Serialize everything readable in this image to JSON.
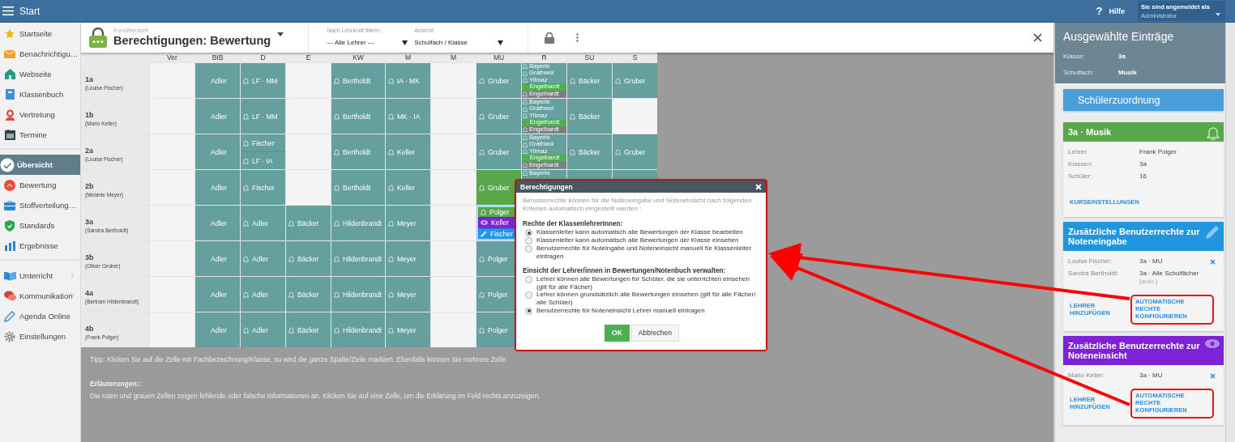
{
  "topbar": {
    "menu": "Start",
    "help_glyph": "?",
    "help": "Hilfe",
    "user_caption": "Sie sind angemeldet als",
    "user_name": "Administrator"
  },
  "sidebar": {
    "groups": [
      [
        {
          "label": "Startseite",
          "selected": false,
          "submenu": false
        },
        {
          "label": "Benachrichtigu…",
          "selected": false,
          "submenu": false
        },
        {
          "label": "Webseite",
          "selected": false,
          "submenu": false
        },
        {
          "label": "Klassenbuch",
          "selected": false,
          "submenu": false
        },
        {
          "label": "Vertretung",
          "selected": false,
          "submenu": false
        },
        {
          "label": "Termine",
          "selected": false,
          "submenu": false
        }
      ],
      [
        {
          "label": "Übersicht",
          "selected": true,
          "submenu": false
        },
        {
          "label": "Bewertung",
          "selected": false,
          "submenu": false
        },
        {
          "label": "Stoffverteilung…",
          "selected": false,
          "submenu": false
        },
        {
          "label": "Standards",
          "selected": false,
          "submenu": false
        },
        {
          "label": "Ergebnisse",
          "selected": false,
          "submenu": false
        }
      ],
      [
        {
          "label": "Unterricht",
          "selected": false,
          "submenu": true
        },
        {
          "label": "Kommunikation",
          "selected": false,
          "submenu": true
        },
        {
          "label": "Agenda Online",
          "selected": false,
          "submenu": false
        },
        {
          "label": "Einstellungen",
          "selected": false,
          "submenu": false
        }
      ]
    ]
  },
  "header": {
    "subtitle": "Kursübersicht",
    "title": "Berechtigungen: Bewertung",
    "filters": [
      {
        "label": "Nach Lehrkraft filtern:",
        "value": "--- Alle Lehrer ---"
      },
      {
        "label": "Ansicht:",
        "value": "Schulfach / Klasse"
      }
    ]
  },
  "grid": {
    "columns": [
      {
        "label": "Ver"
      },
      {
        "label": "BIB"
      },
      {
        "label": "D"
      },
      {
        "label": "E"
      },
      {
        "label": "KW"
      },
      {
        "label": "M"
      },
      {
        "label": "M"
      },
      {
        "label": "MU"
      },
      {
        "label": "R",
        "stacked": true
      },
      {
        "label": "SU"
      },
      {
        "label": "S"
      }
    ],
    "rows": [
      {
        "name": "1a",
        "teacher": "(Louise Fischer)",
        "cells": [
          {
            "filled": false,
            "selected": false
          },
          {
            "filled": true,
            "selected": false,
            "entries": [
              {
                "text": "Adler",
                "kind": "plain"
              }
            ]
          },
          {
            "filled": true,
            "selected": false,
            "entries": [
              {
                "text": "LF · MM",
                "kind": "notify"
              }
            ]
          },
          {
            "filled": false,
            "selected": false
          },
          {
            "filled": true,
            "selected": false,
            "entries": [
              {
                "text": "Bertholdt",
                "kind": "notify"
              }
            ]
          },
          {
            "filled": true,
            "selected": false,
            "entries": [
              {
                "text": "IA · MK",
                "kind": "notify"
              }
            ]
          },
          {
            "filled": false,
            "selected": false
          },
          {
            "filled": true,
            "selected": false,
            "entries": [
              {
                "text": "Gruber",
                "kind": "notify"
              }
            ]
          },
          {
            "filled": true,
            "selected": false,
            "entries": [
              {
                "text": "Bayerle",
                "kind": "notify"
              },
              {
                "text": "Grathwol",
                "kind": "notify"
              },
              {
                "text": "Yilmaz",
                "kind": "notify"
              },
              {
                "text": "Engelhardt",
                "kind": "plain",
                "color": "#4caf50"
              },
              {
                "text": "Engelhardt",
                "kind": "notify",
                "color": "#7d7d7d"
              }
            ]
          },
          {
            "filled": true,
            "selected": false,
            "entries": [
              {
                "text": "Bäcker",
                "kind": "notify"
              }
            ]
          },
          {
            "filled": true,
            "selected": false,
            "entries": [
              {
                "text": "Gruber",
                "kind": "notify"
              }
            ]
          }
        ]
      },
      {
        "name": "1b",
        "teacher": "(Mario Keller)",
        "cells": [
          {
            "filled": false,
            "selected": false
          },
          {
            "filled": true,
            "selected": false,
            "entries": [
              {
                "text": "Adler",
                "kind": "plain"
              }
            ]
          },
          {
            "filled": true,
            "selected": false,
            "entries": [
              {
                "text": "LF · MM",
                "kind": "notify"
              }
            ]
          },
          {
            "filled": false,
            "selected": false
          },
          {
            "filled": true,
            "selected": false,
            "entries": [
              {
                "text": "Bertholdt",
                "kind": "notify"
              }
            ]
          },
          {
            "filled": true,
            "selected": false,
            "entries": [
              {
                "text": "MK · IA",
                "kind": "notify"
              }
            ]
          },
          {
            "filled": false,
            "selected": false
          },
          {
            "filled": true,
            "selected": false,
            "entries": [
              {
                "text": "Gruber",
                "kind": "notify"
              }
            ]
          },
          {
            "filled": true,
            "selected": false,
            "entries": [
              {
                "text": "Bayerle",
                "kind": "notify"
              },
              {
                "text": "Grathwol",
                "kind": "notify"
              },
              {
                "text": "Yilmaz",
                "kind": "notify"
              },
              {
                "text": "Engelhardt",
                "kind": "plain",
                "color": "#4caf50"
              },
              {
                "text": "Engelhardt",
                "kind": "notify",
                "color": "#7d7d7d"
              }
            ]
          },
          {
            "filled": true,
            "selected": false,
            "entries": [
              {
                "text": "Bäcker",
                "kind": "notify"
              }
            ]
          },
          {
            "filled": false,
            "selected": false
          }
        ]
      },
      {
        "name": "2a",
        "teacher": "(Louise Fischer)",
        "cells": [
          {
            "filled": false,
            "selected": false
          },
          {
            "filled": true,
            "selected": false,
            "entries": [
              {
                "text": "Adler",
                "kind": "plain"
              }
            ]
          },
          {
            "filled": true,
            "selected": false,
            "entries": [
              {
                "text": "Fischer",
                "kind": "notify"
              },
              {
                "text": "LF · IA",
                "kind": "notify"
              }
            ]
          },
          {
            "filled": false,
            "selected": false
          },
          {
            "filled": true,
            "selected": false,
            "entries": [
              {
                "text": "Bertholdt",
                "kind": "notify"
              }
            ]
          },
          {
            "filled": true,
            "selected": false,
            "entries": [
              {
                "text": "Keller",
                "kind": "notify"
              }
            ]
          },
          {
            "filled": false,
            "selected": false
          },
          {
            "filled": true,
            "selected": false,
            "entries": [
              {
                "text": "Gruber",
                "kind": "notify"
              }
            ]
          },
          {
            "filled": true,
            "selected": false,
            "entries": [
              {
                "text": "Bayerle",
                "kind": "notify"
              },
              {
                "text": "Grathwol",
                "kind": "notify"
              },
              {
                "text": "Yilmaz",
                "kind": "notify"
              },
              {
                "text": "Engelhardt",
                "kind": "plain",
                "color": "#4caf50"
              },
              {
                "text": "Engelhardt",
                "kind": "notify",
                "color": "#7d7d7d"
              }
            ]
          },
          {
            "filled": true,
            "selected": false,
            "entries": [
              {
                "text": "Bäcker",
                "kind": "notify"
              }
            ]
          },
          {
            "filled": true,
            "selected": false,
            "entries": [
              {
                "text": "Gruber",
                "kind": "notify"
              }
            ]
          }
        ]
      },
      {
        "name": "2b",
        "teacher": "(Melanie Meyer)",
        "cells": [
          {
            "filled": false,
            "selected": false
          },
          {
            "filled": true,
            "selected": false,
            "entries": [
              {
                "text": "Adler",
                "kind": "plain"
              }
            ]
          },
          {
            "filled": true,
            "selected": false,
            "entries": [
              {
                "text": "Fischer",
                "kind": "notify"
              }
            ]
          },
          {
            "filled": false,
            "selected": false
          },
          {
            "filled": true,
            "selected": false,
            "entries": [
              {
                "text": "Bertholdt",
                "kind": "notify"
              }
            ]
          },
          {
            "filled": true,
            "selected": false,
            "entries": [
              {
                "text": "Keller",
                "kind": "notify"
              }
            ]
          },
          {
            "filled": false,
            "selected": false
          },
          {
            "filled": true,
            "selected": false,
            "entries": [
              {
                "text": "Gruber",
                "kind": "notify",
                "color": "#5aa64a"
              }
            ]
          },
          {
            "filled": true,
            "selected": false,
            "entries": [
              {
                "text": "Bayerle",
                "kind": "notify"
              }
            ]
          },
          {
            "filled": true,
            "selected": false
          },
          {
            "filled": true,
            "selected": false
          }
        ]
      },
      {
        "name": "3a",
        "teacher": "(Sandra Bertholdt)",
        "cells": [
          {
            "filled": false,
            "selected": false
          },
          {
            "filled": true,
            "selected": false,
            "entries": [
              {
                "text": "Adler",
                "kind": "plain"
              }
            ]
          },
          {
            "filled": true,
            "selected": false,
            "entries": [
              {
                "text": "Adler",
                "kind": "notify"
              }
            ]
          },
          {
            "filled": true,
            "selected": false,
            "entries": [
              {
                "text": "Bäcker",
                "kind": "notify"
              }
            ]
          },
          {
            "filled": true,
            "selected": false,
            "entries": [
              {
                "text": "Hildenbrandt",
                "kind": "notify"
              }
            ]
          },
          {
            "filled": true,
            "selected": false,
            "entries": [
              {
                "text": "Meyer",
                "kind": "notify"
              }
            ]
          },
          {
            "filled": false,
            "selected": false
          },
          {
            "filled": true,
            "selected": true,
            "entries": [
              {
                "text": "Polger",
                "kind": "notify",
                "color": "#5aa64a"
              },
              {
                "text": "Keller",
                "kind": "view",
                "color": "#7e22d8"
              },
              {
                "text": "Fischer",
                "kind": "edit",
                "color": "#2196e8"
              }
            ]
          }
        ]
      },
      {
        "name": "3b",
        "teacher": "(Oliver Gruber)",
        "cells": [
          {
            "filled": false,
            "selected": false
          },
          {
            "filled": true,
            "selected": false,
            "entries": [
              {
                "text": "Adler",
                "kind": "plain"
              }
            ]
          },
          {
            "filled": true,
            "selected": false,
            "entries": [
              {
                "text": "Adler",
                "kind": "notify"
              }
            ]
          },
          {
            "filled": true,
            "selected": false,
            "entries": [
              {
                "text": "Bäcker",
                "kind": "notify"
              }
            ]
          },
          {
            "filled": true,
            "selected": false,
            "entries": [
              {
                "text": "Hildenbrandt",
                "kind": "notify"
              }
            ]
          },
          {
            "filled": true,
            "selected": false,
            "entries": [
              {
                "text": "Meyer",
                "kind": "notify"
              }
            ]
          },
          {
            "filled": false,
            "selected": false
          },
          {
            "filled": true,
            "selected": false,
            "entries": [
              {
                "text": "Polger",
                "kind": "notify"
              }
            ]
          }
        ]
      },
      {
        "name": "4a",
        "teacher": "(Bertram Hildenbrandt)",
        "cells": [
          {
            "filled": false,
            "selected": false
          },
          {
            "filled": true,
            "selected": false,
            "entries": [
              {
                "text": "Adler",
                "kind": "plain"
              }
            ]
          },
          {
            "filled": true,
            "selected": false,
            "entries": [
              {
                "text": "Adler",
                "kind": "notify"
              }
            ]
          },
          {
            "filled": true,
            "selected": false,
            "entries": [
              {
                "text": "Bäcker",
                "kind": "notify"
              }
            ]
          },
          {
            "filled": true,
            "selected": false,
            "entries": [
              {
                "text": "Hildenbrandt",
                "kind": "notify"
              }
            ]
          },
          {
            "filled": true,
            "selected": false,
            "entries": [
              {
                "text": "Meyer",
                "kind": "notify"
              }
            ]
          },
          {
            "filled": false,
            "selected": false
          },
          {
            "filled": true,
            "selected": false,
            "entries": [
              {
                "text": "Polger",
                "kind": "notify"
              }
            ]
          }
        ]
      },
      {
        "name": "4b",
        "teacher": "(Frank Polger)",
        "cells": [
          {
            "filled": false,
            "selected": false
          },
          {
            "filled": true,
            "selected": false,
            "entries": [
              {
                "text": "Adler",
                "kind": "plain"
              }
            ]
          },
          {
            "filled": true,
            "selected": false,
            "entries": [
              {
                "text": "Adler",
                "kind": "notify"
              }
            ]
          },
          {
            "filled": true,
            "selected": false,
            "entries": [
              {
                "text": "Bäcker",
                "kind": "notify"
              }
            ]
          },
          {
            "filled": true,
            "selected": false,
            "entries": [
              {
                "text": "Hildenbrandt",
                "kind": "notify"
              }
            ]
          },
          {
            "filled": true,
            "selected": false,
            "entries": [
              {
                "text": "Meyer",
                "kind": "notify"
              }
            ]
          },
          {
            "filled": false,
            "selected": false
          },
          {
            "filled": true,
            "selected": false,
            "entries": [
              {
                "text": "Polger",
                "kind": "notify"
              }
            ]
          }
        ]
      }
    ]
  },
  "notes": {
    "tip": "Tipp: Klicken Sie auf die Zelle mit Fachbezeichnung/Klasse, so wird die ganze Spalte/Zeile markiert. Ebenfalls können Sie mehrere Zelle",
    "heading": "Erläuterungen::",
    "text": "Die roten und grauen Zellen zeigen fehlende oder falsche Informationen an. Klicken Sie auf eine Zelle, um die Erklärung im Feld rechts anzuzeigen."
  },
  "dialog": {
    "title": "Berechtigungen",
    "intro": "Benutzerrechte können für die Noteneingabe und Noteneinsicht nach folgenden Kriterien automatisch eingestellt werden :",
    "highlighted": true,
    "groups": [
      {
        "heading": "Rechte der KlassenlehrerInnen:",
        "options": [
          {
            "label": "Klassenleiter kann automatisch alle Bewertungen der Klasse bearbeiten",
            "selected": true
          },
          {
            "label": "Klassenleiter kann automatisch alle Bewertungen der Klasse einsehen",
            "selected": false
          },
          {
            "label": "Benutzerrechte für Noteingabe und Noteneinsicht manuell für Klassenleiter eintragen",
            "selected": false
          }
        ]
      },
      {
        "heading": "Einsicht der Lehrer/innen in Bewertungen/Notenbuch verwalten:",
        "options": [
          {
            "label": "Lehrer können alle Bewertungen für Schüler, die sie unterrichten einsehen (gilt für alle Fächer)",
            "selected": false
          },
          {
            "label": "Lehrer können grundsätzlich alle Bewertungen einsehen (gilt für alle Fächer/ alle Schüler)",
            "selected": false
          },
          {
            "label": "Benutzerrechte für Noteneinsicht Lehrer manuell eintragen",
            "selected": true
          }
        ]
      }
    ],
    "buttons": [
      {
        "label": "OK",
        "kind": "primary"
      },
      {
        "label": "Abbrechen",
        "kind": "secondary"
      }
    ]
  },
  "panel": {
    "title": "Ausgewählte Einträge",
    "fields": [
      {
        "label": "Klasse:",
        "value": "3a"
      },
      {
        "label": "Schulfach:",
        "value": "Musik"
      }
    ],
    "button": "Schülerzuordnung",
    "cards": [
      {
        "kind": "course",
        "title": "3a · Musik",
        "color": "#5aa64a",
        "rows": [
          {
            "label": "Lehrer:",
            "value": "Frank Polger",
            "removable": false
          },
          {
            "label": "Klassen:",
            "value": "3a",
            "removable": false
          },
          {
            "label": "Schüler:",
            "value": "16",
            "removable": false
          }
        ],
        "links": [
          {
            "text": "KURSEINSTELLUNGEN",
            "highlighted": false
          }
        ]
      },
      {
        "kind": "edit",
        "title": "Zusätzliche Benutzerrechte zur Noteneingabe",
        "color": "#2196e0",
        "rows": [
          {
            "label": "Louise Fischer:",
            "value": "3a · MU",
            "removable": true
          },
          {
            "label": "Sandra Bertholdt:",
            "value": "3a · Alle Schulfächer",
            "note": "[auto.]",
            "removable": false
          }
        ],
        "links": [
          {
            "text": "LEHRER HINZUFÜGEN",
            "highlighted": false
          },
          {
            "text": "AUTOMATISCHE RECHTE KONFIGURIEREN",
            "highlighted": true
          }
        ]
      },
      {
        "kind": "view",
        "title": "Zusätzliche Benutzerrechte zur Noteneinsicht",
        "color": "#7e22d8",
        "rows": [
          {
            "label": "Mario Keller:",
            "value": "3a · MU",
            "removable": true
          }
        ],
        "links": [
          {
            "text": "LEHRER HINZUFÜGEN",
            "highlighted": false
          },
          {
            "text": "AUTOMATISCHE RECHTE KONFIGURIEREN",
            "highlighted": true
          }
        ]
      }
    ]
  }
}
